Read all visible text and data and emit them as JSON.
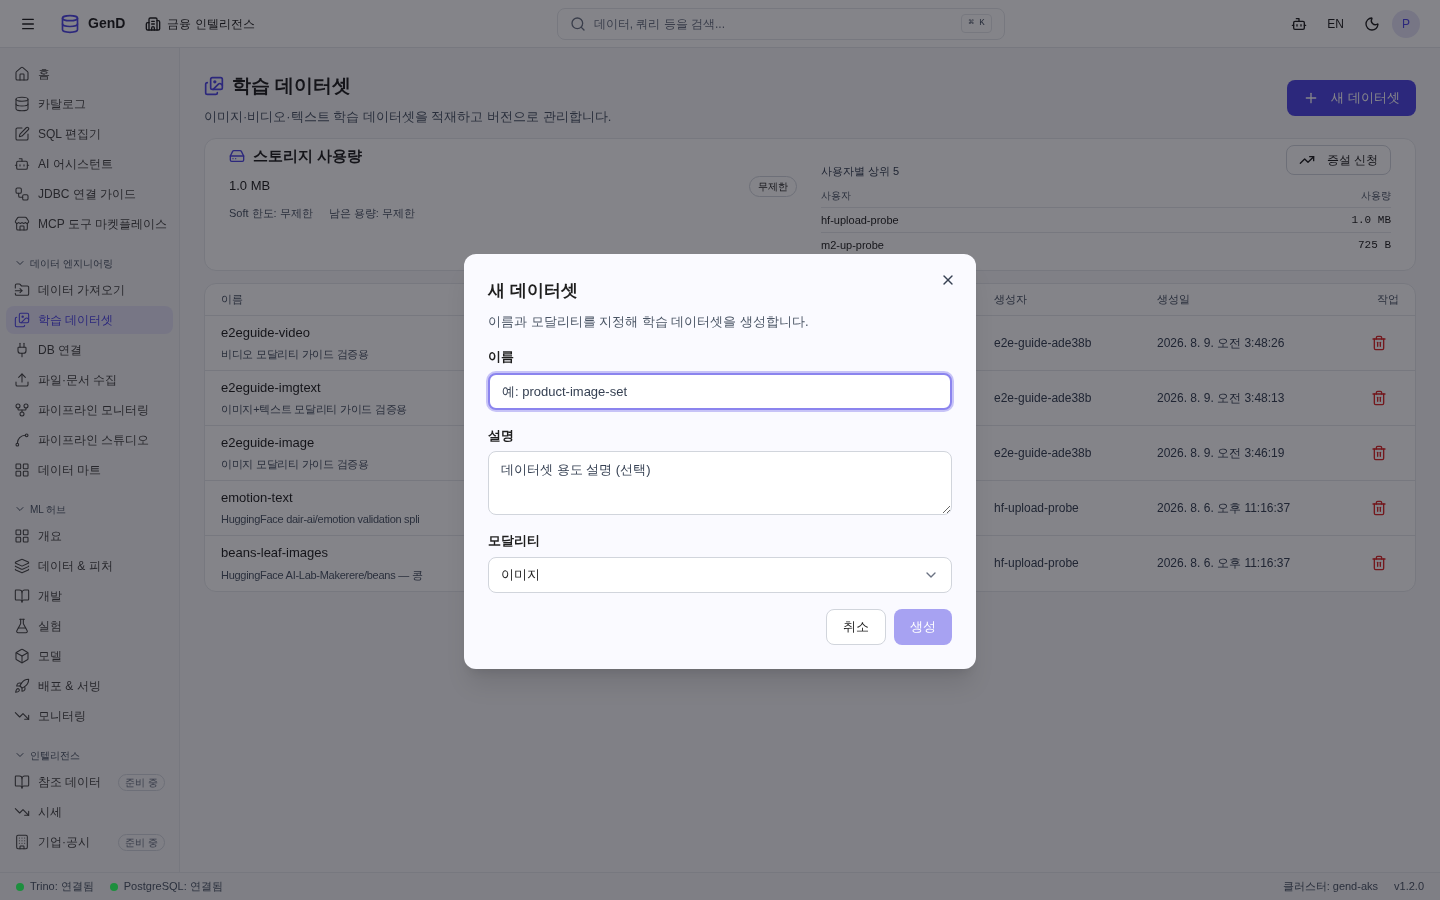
{
  "header": {
    "brand": "GenD",
    "workspace": "금융 인텔리전스",
    "search": {
      "placeholder": "데이터, 쿼리 등을 검색...",
      "shortcut": "⌘ K"
    },
    "language": "EN",
    "avatar": "P"
  },
  "sidebar": {
    "items": [
      {
        "label": "홈",
        "selected": false
      },
      {
        "label": "카탈로그",
        "selected": false
      },
      {
        "label": "SQL 편집기",
        "selected": false
      },
      {
        "label": "AI 어시스턴트",
        "selected": false
      },
      {
        "label": "JDBC 연결 가이드",
        "selected": false
      },
      {
        "label": "MCP 도구 마켓플레이스",
        "selected": false
      }
    ],
    "groups": [
      {
        "label": "데이터 엔지니어링",
        "expanded": true,
        "items": [
          {
            "label": "데이터 가져오기",
            "selected": false
          },
          {
            "label": "학습 데이터셋",
            "selected": true
          },
          {
            "label": "DB 연결",
            "selected": false
          },
          {
            "label": "파일·문서 수집",
            "selected": false
          },
          {
            "label": "파이프라인 모니터링",
            "selected": false
          },
          {
            "label": "파이프라인 스튜디오",
            "selected": false
          },
          {
            "label": "데이터 마트",
            "selected": false
          }
        ]
      },
      {
        "label": "ML 허브",
        "expanded": true,
        "items": [
          {
            "label": "개요",
            "selected": false
          },
          {
            "label": "데이터 & 피처",
            "selected": false
          },
          {
            "label": "개발",
            "selected": false
          },
          {
            "label": "실험",
            "selected": false
          },
          {
            "label": "모델",
            "selected": false
          },
          {
            "label": "배포 & 서빙",
            "selected": false
          },
          {
            "label": "모니터링",
            "selected": false
          }
        ]
      },
      {
        "label": "인텔리전스",
        "expanded": true,
        "items": [
          {
            "label": "참조 데이터",
            "selected": false,
            "badge": "준비 중"
          },
          {
            "label": "시세",
            "selected": false
          },
          {
            "label": "기업·공시",
            "selected": false,
            "badge": "준비 중"
          }
        ]
      }
    ]
  },
  "page": {
    "title": "학습 데이터셋",
    "subtitle": "이미지·비디오·텍스트 학습 데이터셋을 적재하고 버전으로 관리합니다.",
    "new_button": "새 데이터셋"
  },
  "storage": {
    "title": "스토리지 사용량",
    "used": "1.0 MB",
    "soft_limit": "Soft 한도: 무제한",
    "remaining": "남은 용량: 무제한",
    "badge": "무제한",
    "request_button": "증설 신청",
    "top_users": {
      "title": "사용자별 상위 5",
      "columns": [
        "사용자",
        "사용량"
      ],
      "rows": [
        [
          "hf-upload-probe",
          "1.0 MB"
        ],
        [
          "m2-up-probe",
          "725 B"
        ]
      ]
    }
  },
  "table": {
    "columns": [
      "이름",
      "생성자",
      "생성일",
      "작업"
    ],
    "rows": [
      {
        "name": "e2eguide-video",
        "description": "비디오 모달리티 가이드 검증용",
        "creator": "e2e-guide-ade38b",
        "created": "2026. 8. 9. 오전 3:48:26"
      },
      {
        "name": "e2eguide-imgtext",
        "description": "이미지+텍스트 모달리티 가이드 검증용",
        "creator": "e2e-guide-ade38b",
        "created": "2026. 8. 9. 오전 3:48:13"
      },
      {
        "name": "e2eguide-image",
        "description": "이미지 모달리티 가이드 검증용",
        "creator": "e2e-guide-ade38b",
        "created": "2026. 8. 9. 오전 3:46:19"
      },
      {
        "name": "emotion-text",
        "description": "HuggingFace dair-ai/emotion validation spli",
        "creator": "hf-upload-probe",
        "created": "2026. 8. 6. 오후 11:16:37"
      },
      {
        "name": "beans-leaf-images",
        "description": "HuggingFace AI-Lab-Makerere/beans — 콩",
        "creator": "hf-upload-probe",
        "created": "2026. 8. 6. 오후 11:16:37"
      }
    ]
  },
  "dialog": {
    "title": "새 데이터셋",
    "description": "이름과 모달리티를 지정해 학습 데이터셋을 생성합니다.",
    "name_label": "이름",
    "name_placeholder": "예: product-image-set",
    "desc_label": "설명",
    "desc_placeholder": "데이터셋 용도 설명 (선택)",
    "modality_label": "모달리티",
    "modality_value": "이미지",
    "cancel": "취소",
    "create": {
      "label": "생성",
      "disabled": true
    }
  },
  "status_bar": {
    "connections": [
      {
        "label": "Trino: 연결됨",
        "color": "#1d8f3e"
      },
      {
        "label": "PostgreSQL: 연결됨",
        "color": "#1d8f3e"
      }
    ],
    "cluster": "클러스터: gend-aks",
    "version": "v1.2.0"
  }
}
